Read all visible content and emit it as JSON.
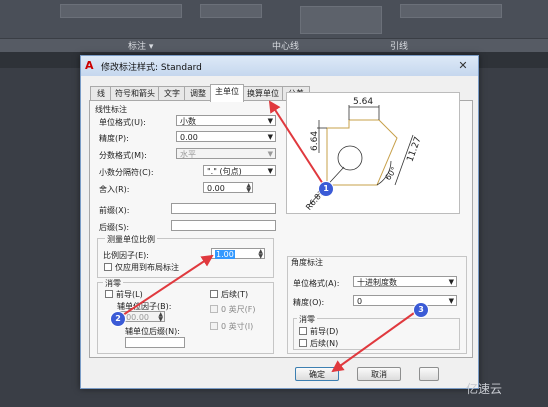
{
  "ribbon": {
    "labels": [
      "标注 ▾",
      "中心线",
      "引线"
    ]
  },
  "dialog": {
    "title": "修改标注样式: Standard",
    "close_label": "✕",
    "tabs": [
      "线",
      "符号和箭头",
      "文字",
      "调整",
      "主单位",
      "换算单位",
      "公差"
    ],
    "active_tab": "主单位",
    "linear": {
      "section_title": "线性标注",
      "unit_format_label": "单位格式(U):",
      "unit_format_value": "小数",
      "precision_label": "精度(P):",
      "precision_value": "0.00",
      "fraction_label": "分数格式(M):",
      "fraction_value": "水平",
      "decimal_sep_label": "小数分隔符(C):",
      "decimal_sep_value": "\".\" (句点)",
      "round_label": "舍入(R):",
      "round_value": "0.00",
      "prefix_label": "前缀(X):",
      "suffix_label": "后缀(S):"
    },
    "scale": {
      "section_title": "测量单位比例",
      "factor_label": "比例因子(E):",
      "factor_value": "1.00",
      "layout_only_label": "仅应用到布局标注"
    },
    "zero_left": {
      "section_title": "消零",
      "leading_label": "前导(L)",
      "trailing_label": "后续(T)",
      "sub_factor_label": "辅单位因子(B):",
      "sub_factor_value": "100.00",
      "feet_label": "0 英尺(F)",
      "inch_label": "0 英寸(I)",
      "sub_suffix_label": "辅单位后缀(N):"
    },
    "angular": {
      "section_title": "角度标注",
      "unit_format_label": "单位格式(A):",
      "unit_format_value": "十进制度数",
      "precision_label": "精度(O):",
      "precision_value": "0"
    },
    "zero_right": {
      "section_title": "消零",
      "leading_label": "前导(D)",
      "trailing_label": "后续(N)"
    },
    "preview": {
      "dim_top": "5.64",
      "dim_left": "6.64",
      "dim_right": "11.27",
      "dim_angle": "60°",
      "dim_radius": "R6.81"
    },
    "buttons": {
      "ok": "确定",
      "cancel": "取消"
    }
  },
  "badges": [
    "1",
    "2",
    "3"
  ],
  "watermark": "亿速云",
  "colors": {
    "badge": "#3b5bd6",
    "arrow": "#e0393e",
    "preview_line": "#c7a04a"
  }
}
